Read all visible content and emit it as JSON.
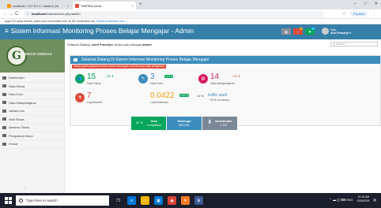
{
  "browser": {
    "tabs": [
      {
        "label": "localhost / 127.0.0.1 / sistemi_kb",
        "close": "×"
      },
      {
        "label": "SIMPBM Ideas",
        "close": "×"
      }
    ],
    "new_tab": "+",
    "window_buttons": [
      "–",
      "□",
      "✕"
    ],
    "nav": {
      "back": "←",
      "forward": "→",
      "reload": "C",
      "home": "⌂"
    },
    "url_host": "localhost",
    "url_path": "/sistemi/index.php/admin",
    "profile": "Paused",
    "bookmarks_text": "Apps  For quick access, place your bookmarks here on the bookmarks bar.",
    "bookmarks_link": "Import bookmarks now..."
  },
  "app": {
    "title": "Sistem Informasi Monitoring Proses Belajar Mengajar - Admin",
    "header_icons": [
      {
        "name": "grid-icon",
        "color": "#8a8f99",
        "badge": "",
        "badge_color": ""
      },
      {
        "name": "bell-icon",
        "color": "#dd4b39",
        "badge": "1",
        "badge_color": "#f39c12"
      },
      {
        "name": "flag-icon",
        "color": "#00a65a",
        "badge": "1",
        "badge_color": "#00c0ef"
      }
    ],
    "user": {
      "greeting": "Halo,",
      "name": "Andi Prasetyo"
    },
    "brand": "GENERASI CERDAS"
  },
  "sidebar": {
    "items": [
      {
        "label": "Dashboard",
        "icon": "dashboard-icon"
      },
      {
        "label": "Data Siswa",
        "icon": "users-icon"
      },
      {
        "label": "Data Guru",
        "icon": "teacher-icon"
      },
      {
        "label": "Data Matapelajaran",
        "icon": "book-icon"
      },
      {
        "label": "Jadwal Les",
        "icon": "calendar-icon"
      },
      {
        "label": "Nilai Siswa",
        "icon": "grades-icon"
      },
      {
        "label": "Absensi Siswa",
        "icon": "attendance-icon"
      },
      {
        "label": "Pengaturan Akun",
        "icon": "settings-icon"
      },
      {
        "label": "Keluar",
        "icon": "logout-icon"
      }
    ],
    "scroll": "⋮"
  },
  "main": {
    "welcome_pre": "Selamat Datang,",
    "welcome_name": "Andi Prasetyo",
    "welcome_mid": ". Anda login sebagai",
    "welcome_role": "admin",
    "search_placeholder": "Q Search...",
    "panel_title": "Selamat Datang Di Sistem Informasi Monitoring Proses Belajar Mengajar",
    "notice": "Harap ganti password Anda untuk mencegah hal-hal yang tidak diinginkan",
    "stats": [
      {
        "num": "15",
        "label": "Data Siswa",
        "change": "6% ⬆",
        "change_color": "#00a65a",
        "circle_color": "#00a65a",
        "icon": "users-icon"
      },
      {
        "num": "3",
        "label": "Data Guru",
        "tag": "12% ⬆",
        "circle_color": "#3c8dbc",
        "icon": "teacher-icon"
      },
      {
        "num": "14",
        "label": "Data Matapelajaran",
        "change": "+4% ⬇",
        "change_color": "#dd4b39",
        "circle_color": "#d81b60",
        "icon": "book-icon"
      },
      {
        "num": "7",
        "label": "experiments",
        "circle_color": "#dd4b39",
        "icon": "flask-icon"
      },
      {
        "num": "0.0422",
        "label": "Load Halaman",
        "tag": "0.5% ⬆",
        "num_color": "#f39c12",
        "icon": ""
      },
      {
        "num": "42 %",
        "label": "traffic used",
        "sub": "~ 8026 remaining",
        "num_color": "#3c8dbc",
        "icon": ""
      }
    ],
    "tiles": [
      {
        "pct": "92 %",
        "title": "Task",
        "sub": "Completion",
        "bg": "#00a65a"
      },
      {
        "pct": "",
        "title": "Earnings",
        "sub": "$32,091",
        "bg": "#3c8dbc"
      },
      {
        "pct": "⬇",
        "title": "Downloads",
        "sub": "1,337",
        "bg": "#7a8796"
      }
    ]
  },
  "taskbar": {
    "search": "Type here to search",
    "apps": [
      {
        "name": "task-view-icon",
        "color": "#1b1f2b",
        "glyph": "❐"
      },
      {
        "name": "edge-icon",
        "color": "#0078d7",
        "glyph": "e"
      },
      {
        "name": "explorer-icon",
        "color": "#f5b400",
        "glyph": "▭"
      },
      {
        "name": "store-icon",
        "color": "#0078d7",
        "glyph": "▦"
      },
      {
        "name": "chrome-icon",
        "color": "#db4437",
        "glyph": "◉"
      },
      {
        "name": "xampp-icon",
        "color": "#fb7a24",
        "glyph": "✕"
      },
      {
        "name": "app-icon",
        "color": "#3b5998",
        "glyph": "⊞"
      }
    ],
    "tray_icons": "⌃ ▬ ◫ ⌨ ENG",
    "time": "10:10 AM",
    "date": "3/29/2019"
  }
}
